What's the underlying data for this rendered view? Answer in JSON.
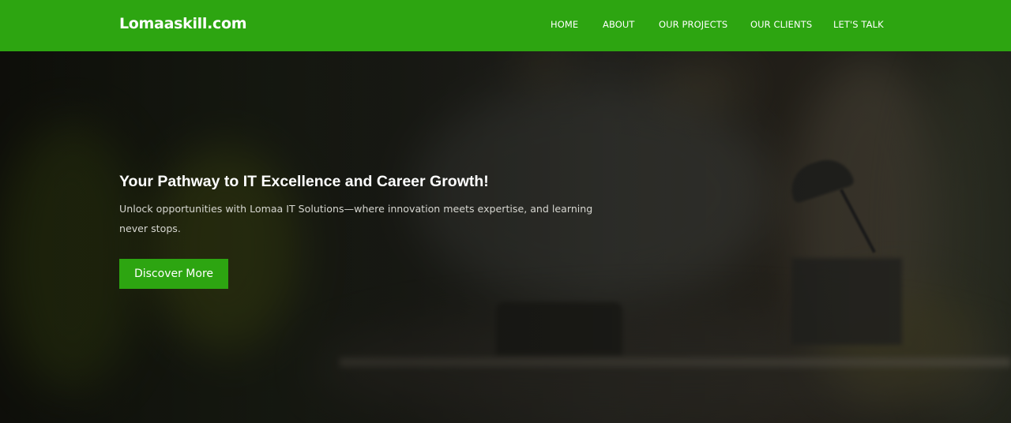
{
  "brand": {
    "name": "Lomaaskill.com",
    "accent": "#2da511"
  },
  "nav": {
    "items": [
      {
        "label": "HOME"
      },
      {
        "label": "ABOUT"
      },
      {
        "label": "OUR PROJECTS"
      },
      {
        "label": "OUR CLIENTS"
      },
      {
        "label": "LET'S TALK"
      }
    ]
  },
  "hero": {
    "headline": "Your Pathway to IT Excellence and Career Growth!",
    "subtext": "Unlock opportunities with Lomaa IT Solutions—where innovation meets expertise, and learning never stops.",
    "cta_label": "Discover More",
    "background": "blurred-office-photo"
  }
}
